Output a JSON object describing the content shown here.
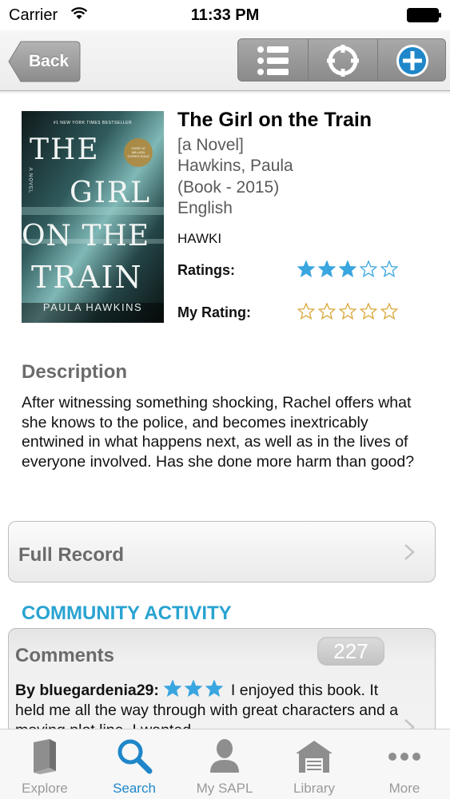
{
  "status_bar": {
    "carrier": "Carrier",
    "time": "11:33 PM"
  },
  "nav": {
    "back_label": "Back",
    "segments": [
      {
        "icon": "list-icon"
      },
      {
        "icon": "locate-icon"
      },
      {
        "icon": "add-circle-icon"
      }
    ]
  },
  "book": {
    "cover": {
      "banner": "#1 NEW YORK TIMES BESTSELLER",
      "sticker": "OVER 10 MILLION COPIES SOLD",
      "novel": "A NOVEL",
      "title_lines": [
        "THE",
        "GIRL",
        "ON THE",
        "TRAIN"
      ],
      "author": "PAULA HAWKINS"
    },
    "title": "The Girl on the Train",
    "subtitle": "[a Novel]",
    "author": "Hawkins, Paula",
    "format": "(Book - 2015)",
    "language": "English",
    "call_number": "HAWKI",
    "ratings_label": "Ratings:",
    "ratings_value": 3,
    "my_rating_label": "My Rating:",
    "my_rating_value": 0,
    "stars_max": 5
  },
  "description": {
    "heading": "Description",
    "text": "After witnessing something shocking, Rachel offers what she knows to the police, and becomes inextricably entwined in what happens next, as well as in the lives of everyone involved. Has she done more harm than good?"
  },
  "full_record": {
    "label": "Full Record"
  },
  "community": {
    "heading": "COMMUNITY ACTIVITY",
    "comments_label": "Comments",
    "comments_count": "227",
    "first_comment": {
      "author": "By bluegardenia29:",
      "rating": 3,
      "text": "I enjoyed this book. It held me all the way through with great characters and a moving plot line. I wanted"
    }
  },
  "tabs": [
    {
      "label": "Explore",
      "icon": "book-icon"
    },
    {
      "label": "Search",
      "icon": "search-icon",
      "active": true
    },
    {
      "label": "My SAPL",
      "icon": "person-icon"
    },
    {
      "label": "Library",
      "icon": "library-icon"
    },
    {
      "label": "More",
      "icon": "more-icon"
    }
  ],
  "colors": {
    "accent": "#1f87c9",
    "heading_blue": "#29a3d1",
    "star_blue": "#3aa6e0",
    "star_gold": "#d9a73a"
  }
}
